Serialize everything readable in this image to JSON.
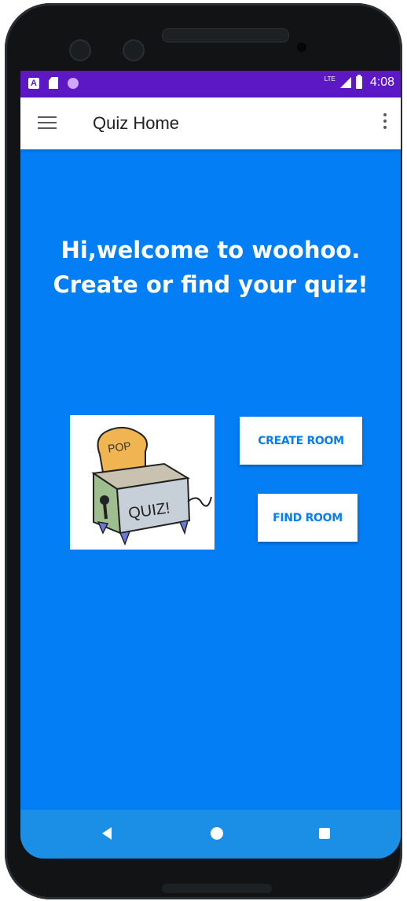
{
  "status_bar": {
    "time": "4:08",
    "network": "LTE",
    "bg_color": "#5b18c4",
    "notification_icons": [
      "a-badge-icon",
      "sd-card-icon",
      "circle-notification-icon"
    ]
  },
  "app_bar": {
    "title": "Quiz Home",
    "menu_icon": "hamburger-menu-icon",
    "overflow_icon": "more-vert-icon"
  },
  "main": {
    "welcome_line1": "Hi,welcome to woohoo.",
    "welcome_line2": "Create or find your quiz!",
    "background_color": "#037ef5",
    "illustration": {
      "label_top": "POP",
      "label_body": "QUIZ!"
    },
    "create_button_label": "CREATE ROOM",
    "find_button_label": "FIND ROOM"
  },
  "nav_bar": {
    "back_icon": "back-triangle-icon",
    "home_icon": "home-circle-icon",
    "recents_icon": "recents-square-icon"
  }
}
